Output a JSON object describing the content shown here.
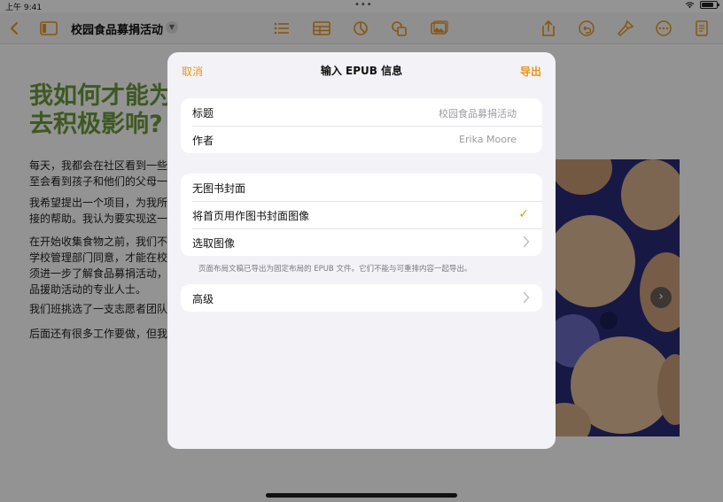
{
  "status": {
    "time": "上午 9:41",
    "dots": "•••"
  },
  "toolbar": {
    "doc_title": "校园食品募捐活动"
  },
  "document": {
    "heading_line1": "我如何才能为",
    "heading_line2": "去积极影响?",
    "paragraphs": [
      [
        "每天，我都会在社区看到一些",
        "至会看到孩子和他们的父母一"
      ],
      [
        "我希望提出一个项目，为我所",
        "接的帮助。我认为要实现这一"
      ],
      [
        "在开始收集食物之前，我们不",
        "学校管理部门同意，才能在校",
        "须进一步了解食品募捐活动，",
        "品援助活动的专业人士。"
      ],
      [
        "我们班挑选了一支志愿者团队"
      ],
      [
        "后面还有很多工作要做，但我"
      ]
    ]
  },
  "sheet": {
    "cancel_label": "取消",
    "title": "输入 EPUB 信息",
    "export_label": "导出",
    "fields": [
      {
        "label": "标题",
        "value": "校园食品募捐活动"
      },
      {
        "label": "作者",
        "value": "Erika Moore"
      }
    ],
    "cover_options": [
      {
        "label": "无图书封面"
      },
      {
        "label": "将首页用作图书封面图像",
        "check": "✓"
      },
      {
        "label": "选取图像"
      }
    ],
    "footnote": "页面布局文稿已导出为固定布局的 EPUB 文件。它们不能与可重排内容一起导出。",
    "advanced_label": "高级"
  },
  "colors": {
    "accent": "#e8951c",
    "heading_green": "#6a9a3c",
    "sheet_bg": "#f2f2f7"
  }
}
